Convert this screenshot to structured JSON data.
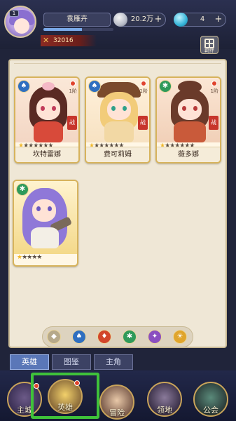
{
  "player": {
    "level": "1",
    "name": "袁雁卉",
    "power": "32016",
    "exp_progress": 0.55
  },
  "currencies": [
    {
      "name": "coin",
      "value": "20.2万",
      "icon": "silver-coin-icon"
    },
    {
      "name": "gem",
      "value": "4",
      "icon": "blue-gem-icon"
    }
  ],
  "panel": {
    "handbook_label": "羁绊"
  },
  "heroes": [
    {
      "name": "坎特雷娜",
      "element_icon": "water-element-icon",
      "element_color": "#2f6fc0",
      "stars": 7,
      "lit_stars": 1,
      "stage": "1阶"
    },
    {
      "name": "费可莉姆",
      "element_icon": "water-element-icon",
      "element_color": "#2f6fc0",
      "stars": 7,
      "lit_stars": 1,
      "stage": "1阶"
    },
    {
      "name": "薇多娜",
      "element_icon": "wind-element-icon",
      "element_color": "#2f9a5a",
      "stars": 7,
      "lit_stars": 1,
      "stage": "1阶"
    },
    {
      "name": "",
      "element_icon": "wind-element-icon",
      "element_color": "#2f9a5a",
      "stars": 5,
      "lit_stars": 1,
      "stage": ""
    }
  ],
  "filters": [
    {
      "icon": "all-filter-icon",
      "color": "#b6a98a",
      "glyph": "◆"
    },
    {
      "icon": "water-filter-icon",
      "color": "#2f6fc0",
      "glyph": "♠"
    },
    {
      "icon": "fire-filter-icon",
      "color": "#d2462a",
      "glyph": "♦"
    },
    {
      "icon": "wind-filter-icon",
      "color": "#2f9a5a",
      "glyph": "✱"
    },
    {
      "icon": "dark-filter-icon",
      "color": "#8a4fc0",
      "glyph": "✦"
    },
    {
      "icon": "light-filter-icon",
      "color": "#e0a52c",
      "glyph": "☀"
    }
  ],
  "tabs": [
    {
      "label": "英雄",
      "active": true
    },
    {
      "label": "图鉴",
      "active": false
    },
    {
      "label": "主角",
      "active": false
    }
  ],
  "nav": [
    {
      "label": "主城",
      "icon": "main-city-icon",
      "dot": true
    },
    {
      "label": "英雄",
      "icon": "hero-icon",
      "dot": true
    },
    {
      "label": "冒险",
      "icon": "adventure-icon",
      "dot": false
    },
    {
      "label": "领地",
      "icon": "territory-icon",
      "dot": false
    },
    {
      "label": "公会",
      "icon": "guild-icon",
      "dot": false
    }
  ],
  "colors": {
    "highlight": "#3fc23a",
    "star_lit": "#f0b82b",
    "panel_bg": "#efe7d6"
  }
}
